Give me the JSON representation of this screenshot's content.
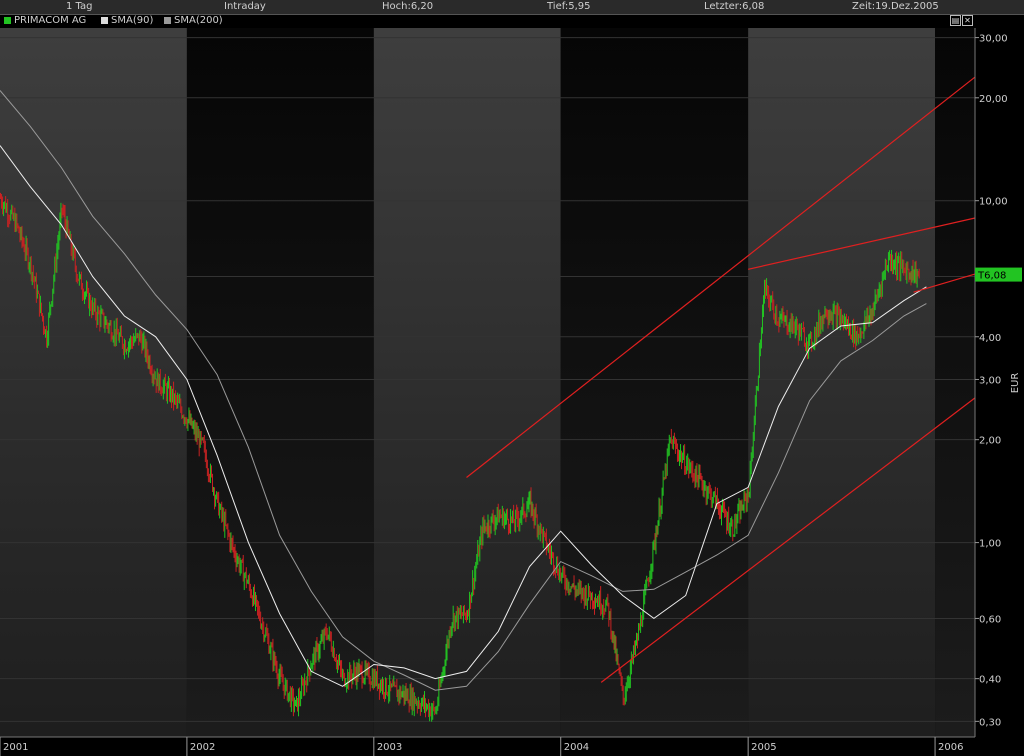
{
  "header": {
    "period": "1 Tag",
    "mode": "Intraday",
    "high": "Hoch:6,20",
    "low": "Tief:5,95",
    "last": "Letzter:6,08",
    "time": "Zeit:19.Dez.2005"
  },
  "legend": [
    {
      "label": "PRIMACOM AG",
      "color": "#22c422"
    },
    {
      "label": "SMA(90)",
      "color": "#dddddd"
    },
    {
      "label": "SMA(200)",
      "color": "#9a9a9a"
    }
  ],
  "window_buttons": {
    "maximize": "▤",
    "close": "✕"
  },
  "colors": {
    "up": "#22c422",
    "down": "#c82222",
    "sma90": "#eeeeee",
    "sma200": "#9a9a9a",
    "trend": "#e02020",
    "band_light": "#3a3a3a",
    "band_dark": "#050505",
    "badge": "#22c422"
  },
  "chart_data": {
    "type": "line",
    "ylabel": "EUR",
    "yscale": "log",
    "ylim": [
      0.27,
      32
    ],
    "xlim": [
      "2001-01-01",
      "2006-03-20"
    ],
    "yticks": [
      {
        "value": 30,
        "label": "30,00"
      },
      {
        "value": 20,
        "label": "20,00"
      },
      {
        "value": 10,
        "label": "10,00"
      },
      {
        "value": 6,
        "label": "6,00"
      },
      {
        "value": 4,
        "label": "4,00"
      },
      {
        "value": 3,
        "label": "3,00"
      },
      {
        "value": 2,
        "label": "2,00"
      },
      {
        "value": 1,
        "label": "1,00"
      },
      {
        "value": 0.6,
        "label": "0,60"
      },
      {
        "value": 0.4,
        "label": "0,40"
      },
      {
        "value": 0.3,
        "label": "0,30"
      }
    ],
    "xticks": [
      {
        "date": "2001-01-01",
        "label": "2001"
      },
      {
        "date": "2002-01-01",
        "label": "2002"
      },
      {
        "date": "2003-01-01",
        "label": "2003"
      },
      {
        "date": "2004-01-01",
        "label": "2004"
      },
      {
        "date": "2005-01-01",
        "label": "2005"
      },
      {
        "date": "2006-01-01",
        "label": "2006"
      }
    ],
    "last_value_label": "T6,08",
    "last_value": 6.08,
    "series": [
      {
        "name": "PRIMACOM AG",
        "x": [
          "2001-01-01",
          "2001-02-01",
          "2001-03-01",
          "2001-04-01",
          "2001-05-01",
          "2001-06-01",
          "2001-07-01",
          "2001-08-01",
          "2001-09-01",
          "2001-10-01",
          "2001-11-01",
          "2001-12-01",
          "2002-01-01",
          "2002-02-01",
          "2002-03-01",
          "2002-04-01",
          "2002-05-01",
          "2002-06-01",
          "2002-07-01",
          "2002-08-01",
          "2002-09-01",
          "2002-10-01",
          "2002-11-01",
          "2002-12-01",
          "2003-01-01",
          "2003-02-01",
          "2003-03-01",
          "2003-04-01",
          "2003-05-01",
          "2003-06-01",
          "2003-07-01",
          "2003-08-01",
          "2003-09-01",
          "2003-10-01",
          "2003-11-01",
          "2003-12-01",
          "2004-01-01",
          "2004-02-01",
          "2004-03-01",
          "2004-04-01",
          "2004-05-01",
          "2004-06-01",
          "2004-07-01",
          "2004-08-01",
          "2004-09-01",
          "2004-10-01",
          "2004-11-01",
          "2004-12-01",
          "2005-01-01",
          "2005-02-01",
          "2005-03-01",
          "2005-04-01",
          "2005-05-01",
          "2005-06-01",
          "2005-07-01",
          "2005-08-01",
          "2005-09-01",
          "2005-10-01",
          "2005-11-01",
          "2005-12-01"
        ],
        "values": [
          10.2,
          8.5,
          6.5,
          4.0,
          9.5,
          6.0,
          4.8,
          4.3,
          3.8,
          4.0,
          3.0,
          2.7,
          2.3,
          1.9,
          1.3,
          0.95,
          0.75,
          0.55,
          0.4,
          0.33,
          0.45,
          0.55,
          0.4,
          0.42,
          0.4,
          0.37,
          0.36,
          0.34,
          0.32,
          0.6,
          0.62,
          1.1,
          1.2,
          1.15,
          1.3,
          1.0,
          0.8,
          0.72,
          0.7,
          0.65,
          0.35,
          0.55,
          1.0,
          2.0,
          1.7,
          1.5,
          1.3,
          1.1,
          1.4,
          5.5,
          4.5,
          4.3,
          3.8,
          4.8,
          4.5,
          4.0,
          4.8,
          6.8,
          6.3,
          6.08
        ]
      },
      {
        "name": "SMA(90)",
        "x": [
          "2001-01-01",
          "2001-03-01",
          "2001-05-01",
          "2001-07-01",
          "2001-09-01",
          "2001-11-01",
          "2002-01-01",
          "2002-03-01",
          "2002-05-01",
          "2002-07-01",
          "2002-09-01",
          "2002-11-01",
          "2003-01-01",
          "2003-03-01",
          "2003-05-01",
          "2003-07-01",
          "2003-09-01",
          "2003-11-01",
          "2004-01-01",
          "2004-03-01",
          "2004-05-01",
          "2004-07-01",
          "2004-09-01",
          "2004-11-01",
          "2005-01-01",
          "2005-03-01",
          "2005-05-01",
          "2005-07-01",
          "2005-09-01",
          "2005-11-01",
          "2005-12-15"
        ],
        "values": [
          14.5,
          11.0,
          8.5,
          6.0,
          4.6,
          4.0,
          3.0,
          1.8,
          1.0,
          0.62,
          0.42,
          0.38,
          0.44,
          0.43,
          0.4,
          0.42,
          0.55,
          0.85,
          1.08,
          0.86,
          0.7,
          0.6,
          0.7,
          1.3,
          1.45,
          2.5,
          3.7,
          4.3,
          4.4,
          5.1,
          5.6
        ]
      },
      {
        "name": "SMA(200)",
        "x": [
          "2001-01-01",
          "2001-03-01",
          "2001-05-01",
          "2001-07-01",
          "2001-09-01",
          "2001-11-01",
          "2002-01-01",
          "2002-03-01",
          "2002-05-01",
          "2002-07-01",
          "2002-09-01",
          "2002-11-01",
          "2003-01-01",
          "2003-03-01",
          "2003-05-01",
          "2003-07-01",
          "2003-09-01",
          "2003-11-01",
          "2004-01-01",
          "2004-03-01",
          "2004-05-01",
          "2004-07-01",
          "2004-09-01",
          "2004-11-01",
          "2005-01-01",
          "2005-03-01",
          "2005-05-01",
          "2005-07-01",
          "2005-09-01",
          "2005-11-01",
          "2005-12-15"
        ],
        "values": [
          21.0,
          16.5,
          12.5,
          9.0,
          7.0,
          5.3,
          4.2,
          3.1,
          1.9,
          1.05,
          0.72,
          0.53,
          0.45,
          0.41,
          0.37,
          0.38,
          0.48,
          0.66,
          0.88,
          0.8,
          0.72,
          0.73,
          0.82,
          0.92,
          1.05,
          1.6,
          2.6,
          3.4,
          3.9,
          4.6,
          5.0
        ]
      }
    ],
    "trendlines": [
      {
        "from": [
          "2003-07-01",
          1.55
        ],
        "to": [
          "2006-03-20",
          23.0
        ]
      },
      {
        "from": [
          "2004-03-20",
          0.39
        ],
        "to": [
          "2006-03-20",
          2.65
        ]
      },
      {
        "from": [
          "2005-01-01",
          6.3
        ],
        "to": [
          "2006-03-20",
          8.9
        ]
      },
      {
        "from": [
          "2005-11-20",
          5.4
        ],
        "to": [
          "2006-03-20",
          6.1
        ]
      }
    ]
  }
}
